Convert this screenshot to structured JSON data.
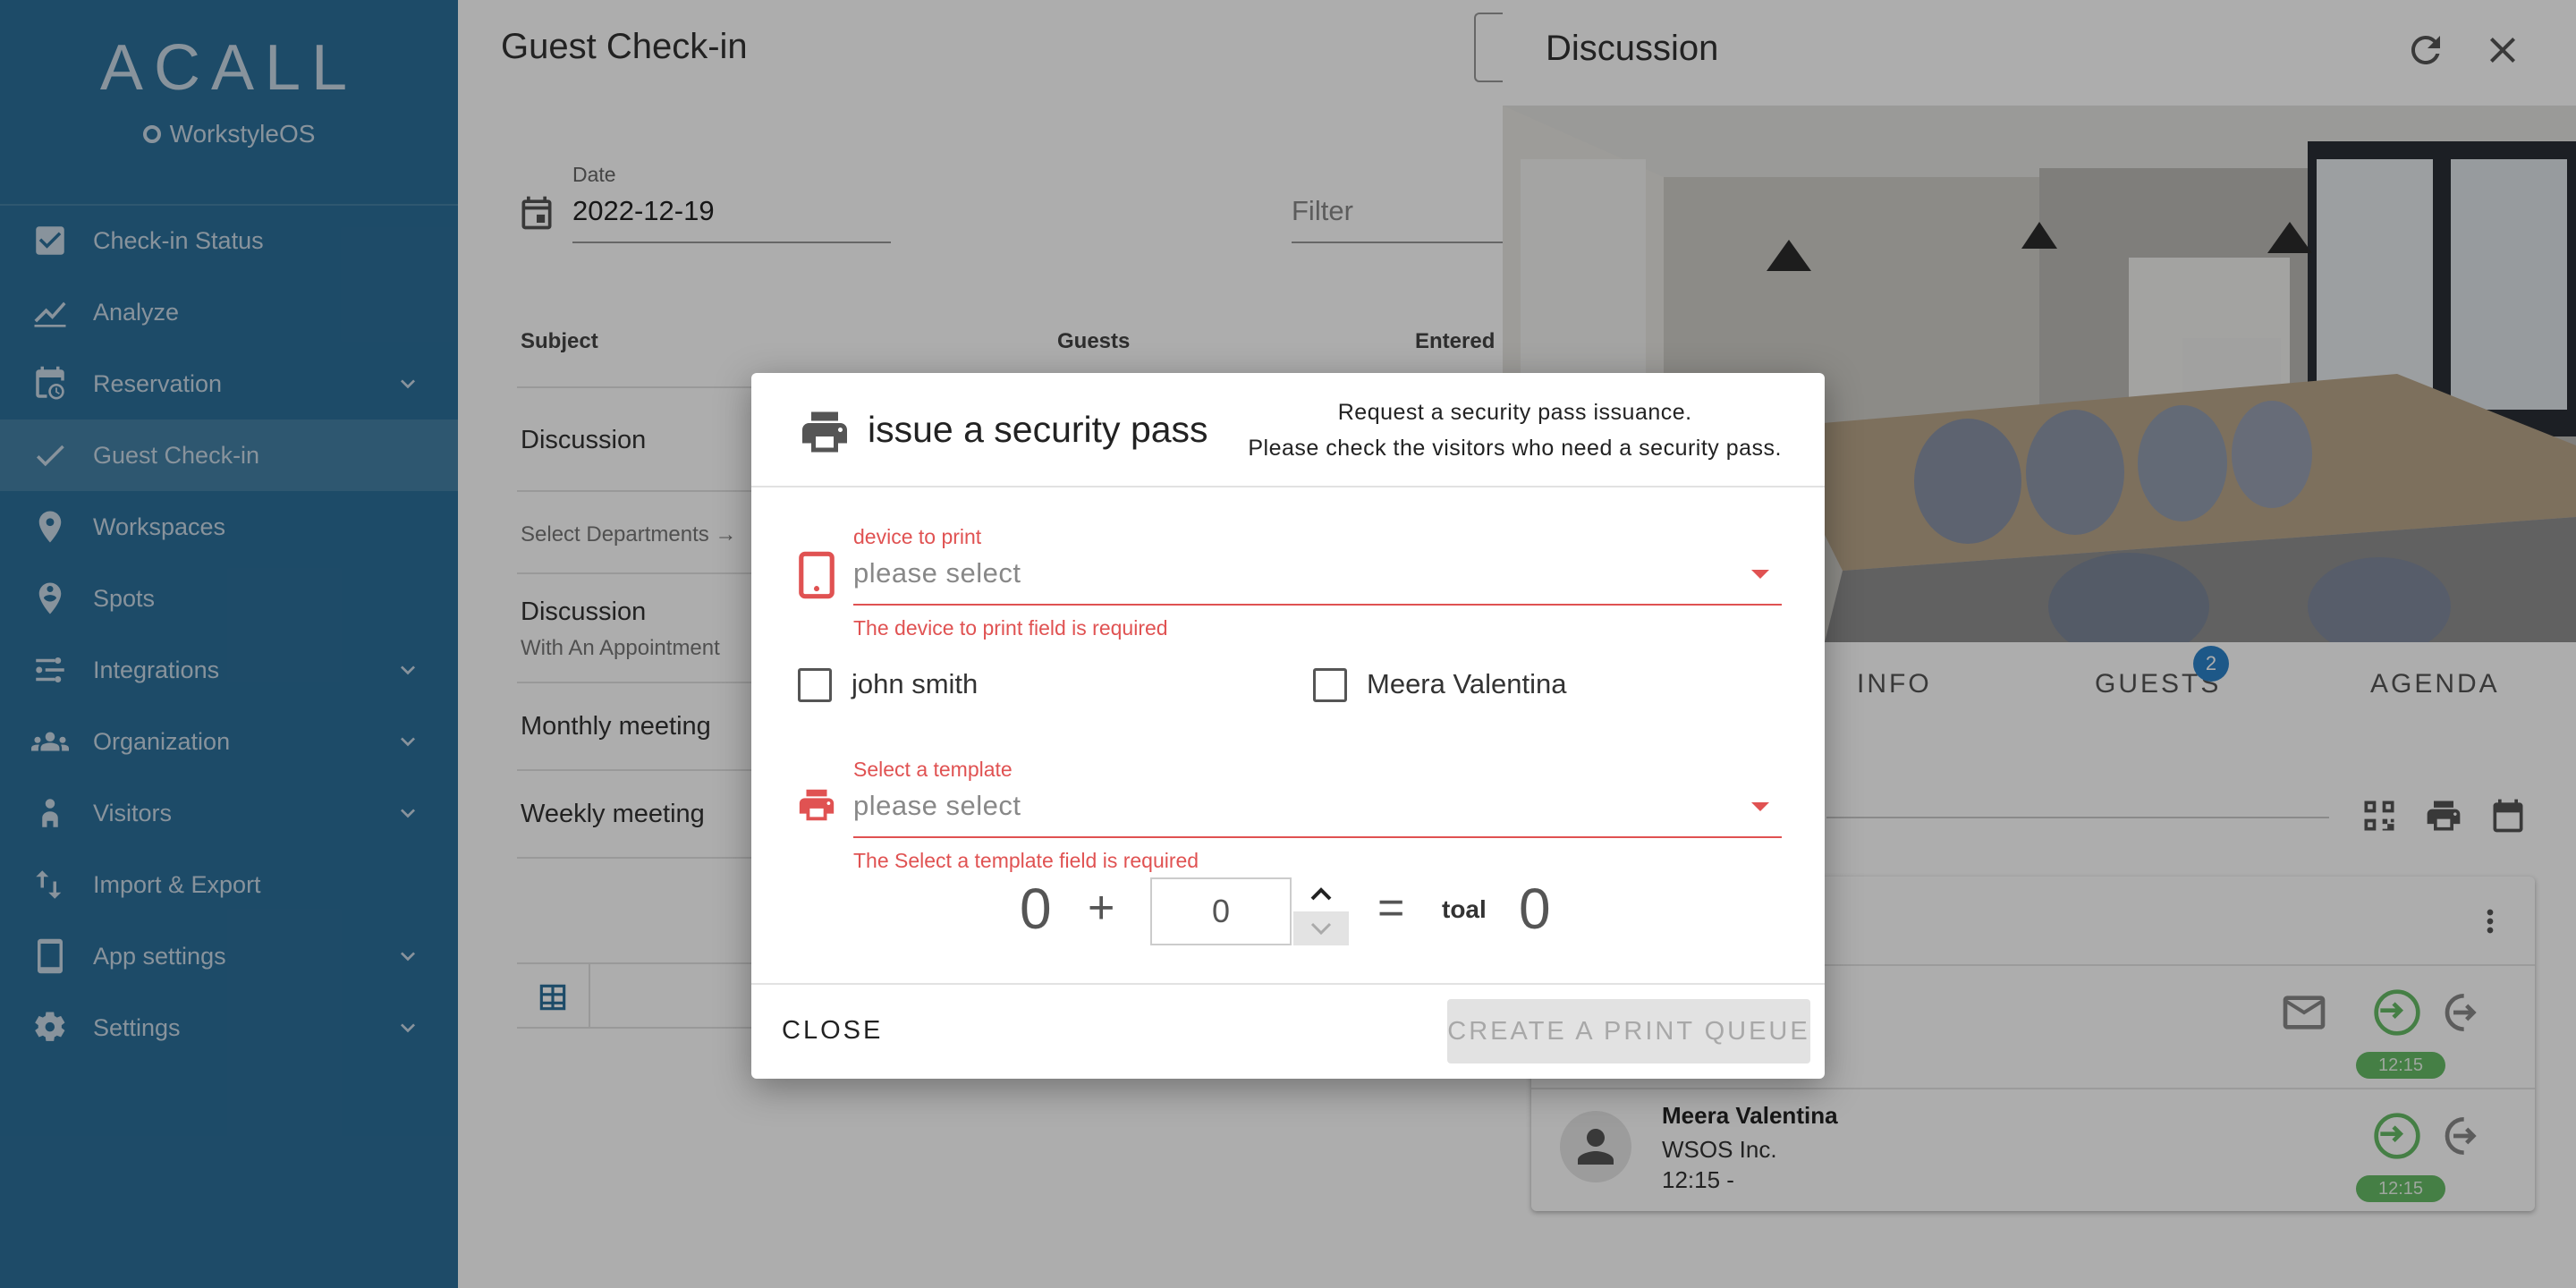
{
  "app": {
    "logo": "ACALL",
    "sub_brand": "WorkstyleOS"
  },
  "sidebar": {
    "items": [
      {
        "label": "Check-in Status",
        "icon": "checkbox-icon",
        "chevron": false,
        "active": false
      },
      {
        "label": "Analyze",
        "icon": "chart-line-icon",
        "chevron": false,
        "active": false
      },
      {
        "label": "Reservation",
        "icon": "calendar-clock-icon",
        "chevron": true,
        "active": false
      },
      {
        "label": "Guest Check-in",
        "icon": "check-icon",
        "chevron": false,
        "active": true
      },
      {
        "label": "Workspaces",
        "icon": "location-pin-icon",
        "chevron": false,
        "active": false
      },
      {
        "label": "Spots",
        "icon": "person-pin-icon",
        "chevron": false,
        "active": false
      },
      {
        "label": "Integrations",
        "icon": "integrations-icon",
        "chevron": true,
        "active": false
      },
      {
        "label": "Organization",
        "icon": "people-icon",
        "chevron": true,
        "active": false
      },
      {
        "label": "Visitors",
        "icon": "visitor-icon",
        "chevron": true,
        "active": false
      },
      {
        "label": "Import & Export",
        "icon": "import-export-icon",
        "chevron": false,
        "active": false
      },
      {
        "label": "App settings",
        "icon": "tablet-icon",
        "chevron": true,
        "active": false
      },
      {
        "label": "Settings",
        "icon": "gear-icon",
        "chevron": true,
        "active": false
      }
    ]
  },
  "main": {
    "title": "Guest Check-in",
    "date_label": "Date",
    "date_value": "2022-12-19",
    "filter_placeholder": "Filter",
    "columns": {
      "subject": "Subject",
      "guests": "Guests",
      "entered": "Entered"
    },
    "rows": {
      "r1": "Discussion",
      "r2": "Select Departments →",
      "r3": "Discussion",
      "r3_sub": "With An Appointment",
      "r4": "Monthly meeting",
      "r5": "Weekly meeting"
    }
  },
  "panel": {
    "title": "Discussion",
    "tabs": {
      "info": "INFO",
      "guests": "GUESTS",
      "agenda": "AGENDA"
    },
    "guest_count": "2",
    "guest1": {
      "time_pill": "12:15"
    },
    "guest2": {
      "name": "Meera Valentina",
      "company": "WSOS Inc.",
      "time": "12:15  -",
      "time_pill": "12:15"
    }
  },
  "dialog": {
    "title": "issue a security pass",
    "desc_line1": "Request a security pass issuance.",
    "desc_line2": "Please check the visitors who need a security pass.",
    "device": {
      "label": "device to print",
      "value": "please select",
      "error": "The device to print field is required"
    },
    "guests": [
      {
        "name": "john smith",
        "checked": false
      },
      {
        "name": "Meera Valentina",
        "checked": false
      }
    ],
    "template": {
      "label": "Select a template",
      "value": "please select",
      "error": "The Select a template field is required"
    },
    "calc": {
      "base": "0",
      "plus": "+",
      "extra": "0",
      "equals": "=",
      "total_label": "toal",
      "total": "0"
    },
    "close_label": "CLOSE",
    "create_label": "CREATE A PRINT QUEUE"
  },
  "colors": {
    "sidebar": "#2c6f9a",
    "error": "#e05252",
    "success": "#66bb66",
    "badge": "#2c82c9"
  }
}
